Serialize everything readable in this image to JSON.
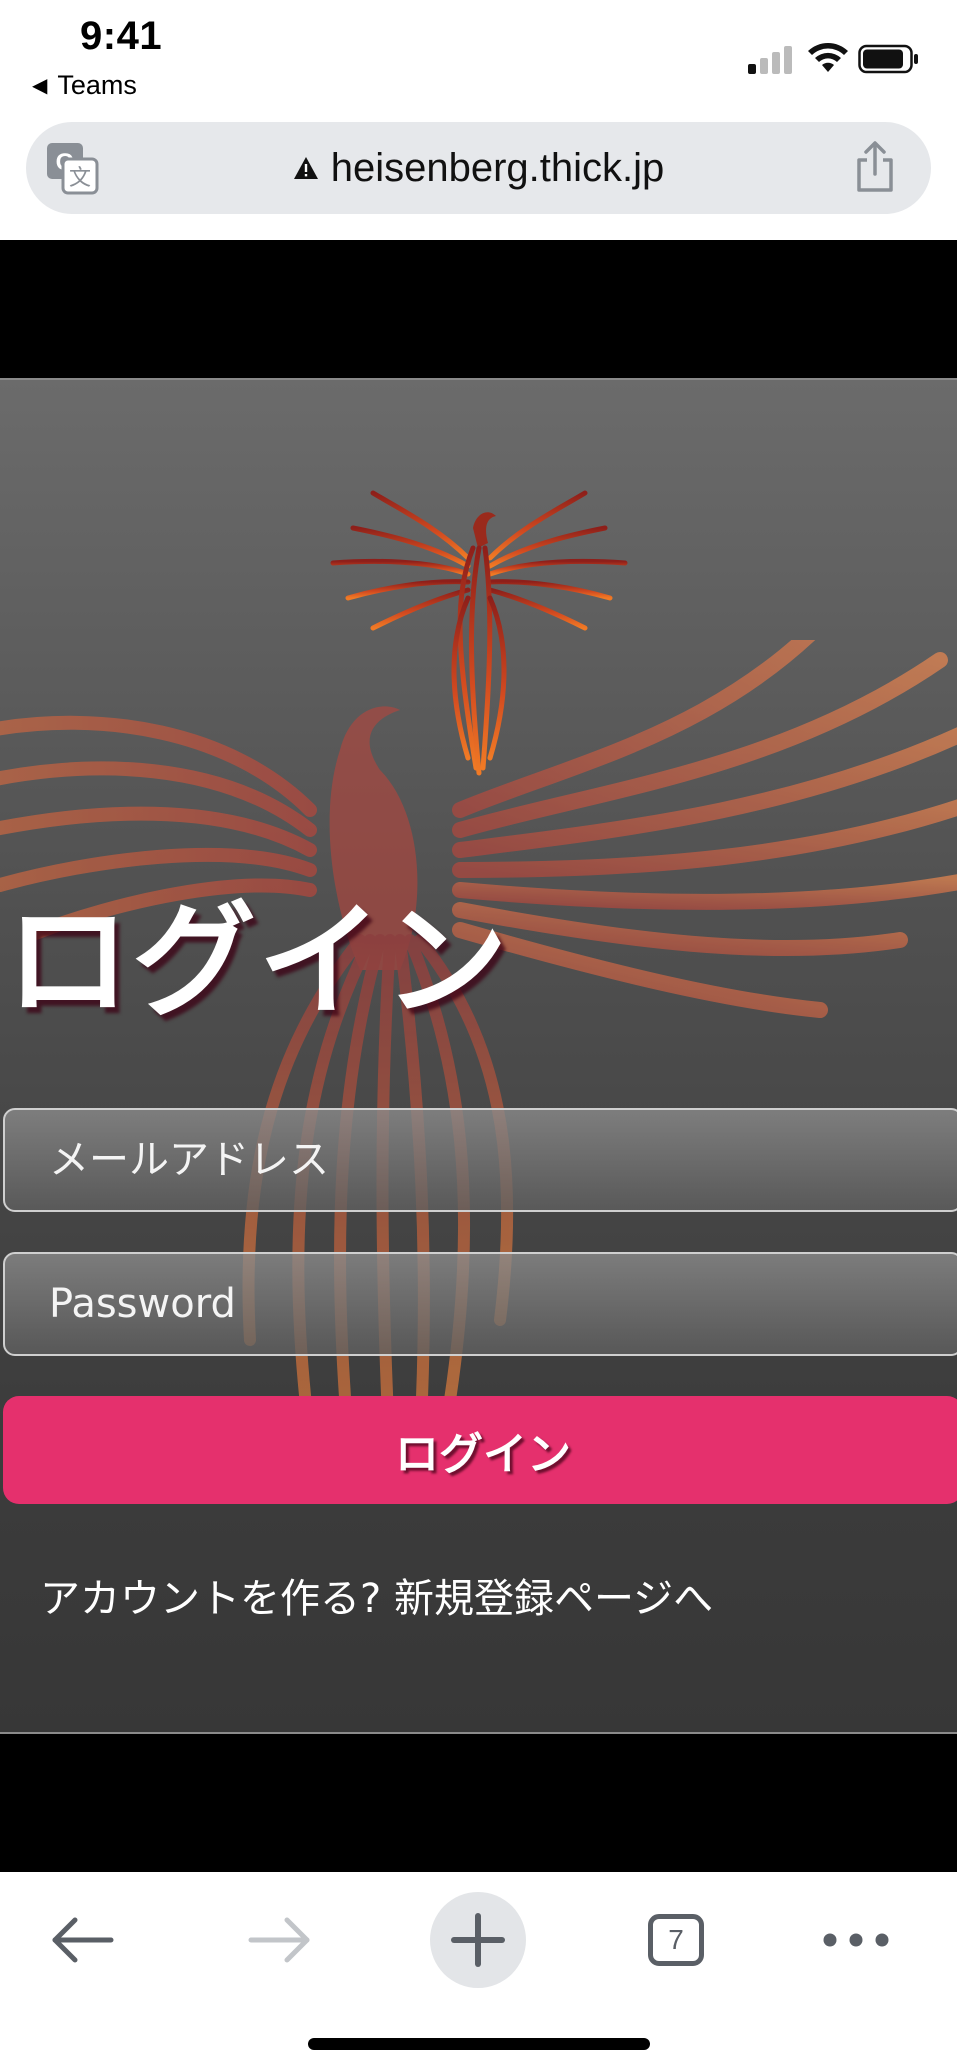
{
  "status_bar": {
    "time": "9:41",
    "back_app": "Teams"
  },
  "address_bar": {
    "url": "heisenberg.thick.jp"
  },
  "page": {
    "title": "ログイン",
    "email_placeholder": "メールアドレス",
    "password_placeholder": "Password",
    "login_button": "ログイン",
    "register_link": "アカウントを作る? 新規登録ページへ"
  },
  "toolbar": {
    "tab_count": "7"
  },
  "colors": {
    "accent": "#e5306d",
    "phoenix": "#e0602a"
  },
  "icons": [
    "translate-icon",
    "warning-icon",
    "share-icon",
    "back-arrow-icon",
    "forward-arrow-icon",
    "plus-icon",
    "tabs-icon",
    "more-icon"
  ]
}
